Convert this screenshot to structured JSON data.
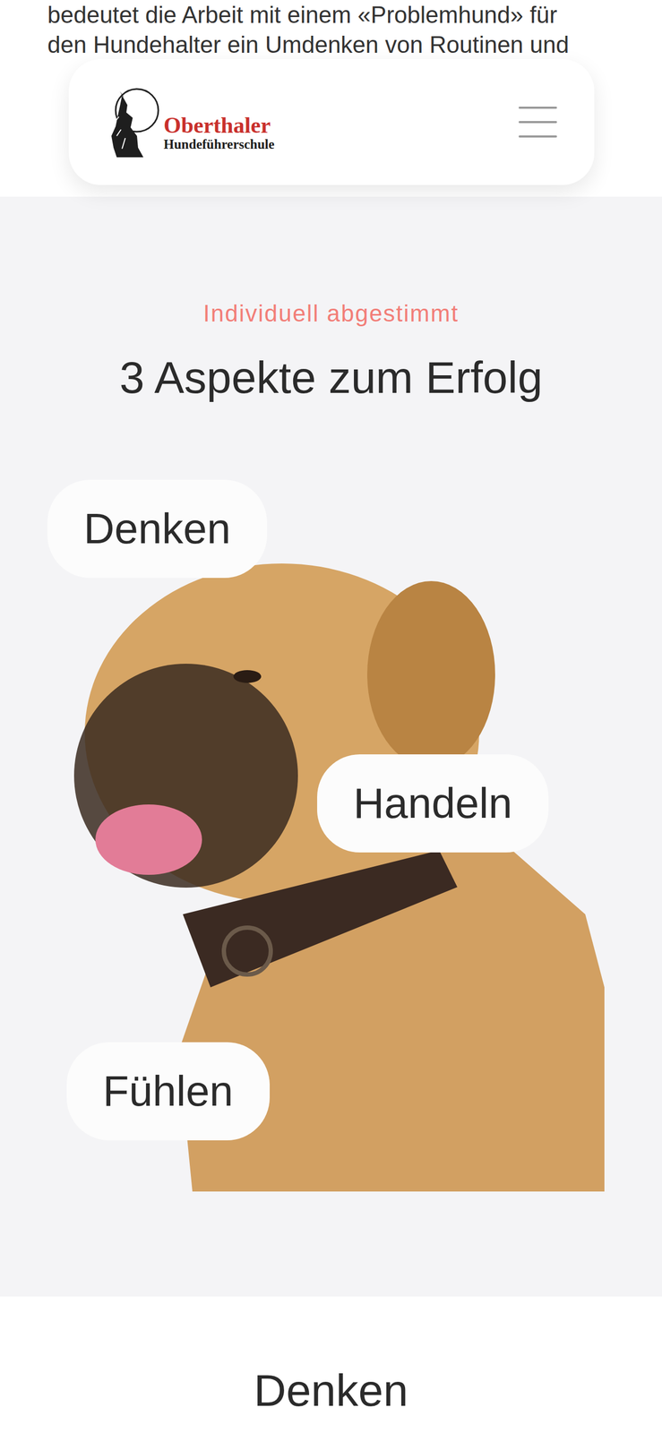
{
  "intro": {
    "lines": [
      "bedeutet die Arbeit mit einem «Problemhund» für",
      "den Hundehalter ein Umdenken von Routinen und"
    ]
  },
  "header": {
    "logo": {
      "title": "Oberthaler",
      "subtitle": "Hundeführerschule"
    }
  },
  "section": {
    "eyebrow": "Individuell abgestimmt",
    "title": "3 Aspekte zum Erfolg",
    "aspects": [
      {
        "label": "Denken"
      },
      {
        "label": "Handeln"
      },
      {
        "label": "Fühlen"
      }
    ]
  },
  "next_section": {
    "title": "Denken"
  }
}
